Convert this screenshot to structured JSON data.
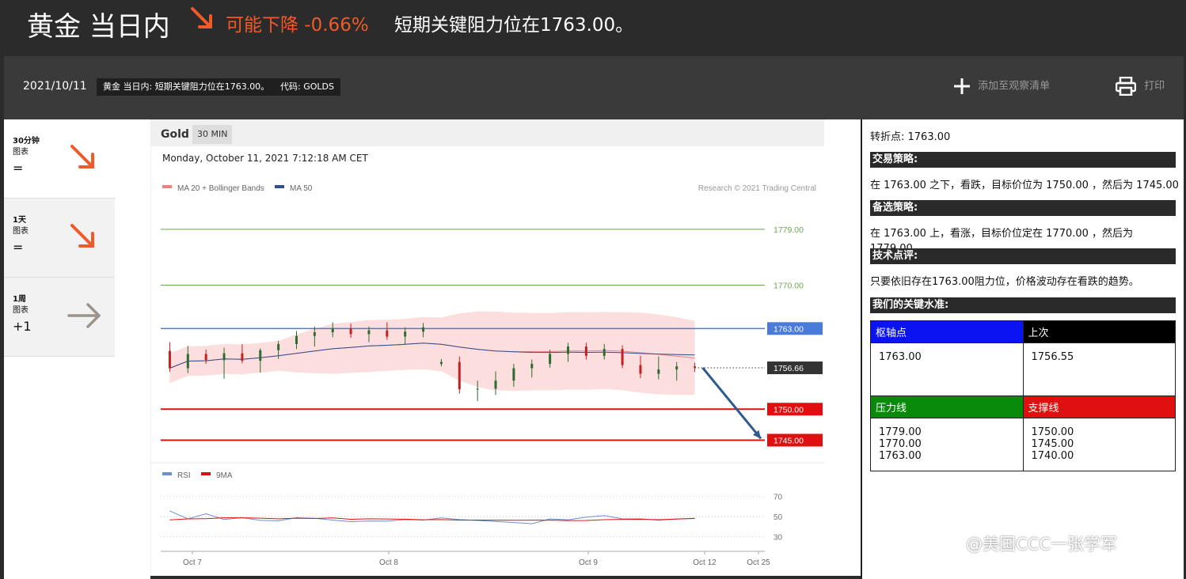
{
  "header": {
    "title": "黄金 当日内",
    "direction_label": "可能下降 -0.66%",
    "headline": "短期关键阻力位在1763.00。",
    "accent": "#f05a28"
  },
  "infobar": {
    "date": "2021/10/11",
    "summary_tag": "黄金 当日内: 短期关键阻力位在1763.00。",
    "code_tag": "代码: GOLDS",
    "watchlist_label": "添加至观察清单",
    "print_label": "打印"
  },
  "timeframes": [
    {
      "line1": "30分钟",
      "line2": "图表",
      "change": "=",
      "icon": "arrow-down-right-icon"
    },
    {
      "line1": "1天",
      "line2": "图表",
      "change": "=",
      "icon": "arrow-down-right-icon"
    },
    {
      "line1": "1周",
      "line2": "图表",
      "change": "+1",
      "icon": "arrow-right-icon"
    }
  ],
  "chart_header": {
    "symbol": "Gold",
    "timeframe": "30 MIN",
    "timestamp": "Monday, October 11, 2021 7:12:18 AM CET"
  },
  "chart_data": [
    {
      "type": "candlestick",
      "legend": [
        {
          "name": "MA 20 + Bollinger Bands",
          "color": "#f08080"
        },
        {
          "name": "MA 50",
          "color": "#2e4e8c"
        }
      ],
      "credit": "Research © 2021 Trading Central",
      "ylim": [
        1742,
        1786
      ],
      "levels": [
        {
          "value": 1779.0,
          "label": "1779.00",
          "color": "#6aa84f",
          "style": "thin",
          "label_style": "text"
        },
        {
          "value": 1770.0,
          "label": "1770.00",
          "color": "#6aa84f",
          "style": "thin",
          "label_style": "text"
        },
        {
          "value": 1763.0,
          "label": "1763.00",
          "color": "#4a7bd8",
          "style": "medium",
          "label_style": "box"
        },
        {
          "value": 1756.66,
          "label": "1756.66",
          "color": "#333333",
          "style": "dotted",
          "label_style": "box"
        },
        {
          "value": 1750.0,
          "label": "1750.00",
          "color": "#e01010",
          "style": "thick",
          "label_style": "box"
        },
        {
          "value": 1745.0,
          "label": "1745.00",
          "color": "#e01010",
          "style": "thick",
          "label_style": "box"
        }
      ],
      "x_ticks": [
        "Oct 7",
        "Oct 8",
        "Oct 9",
        "Oct 12",
        "Oct 25"
      ],
      "forecast_arrow": {
        "from": 1756.66,
        "to": 1745.0,
        "color": "#2e5a8c"
      },
      "candles": [
        {
          "o": 1759.4,
          "h": 1760.8,
          "l": 1756.0,
          "c": 1756.6
        },
        {
          "o": 1756.6,
          "h": 1760.2,
          "l": 1755.8,
          "c": 1758.9
        },
        {
          "o": 1758.9,
          "h": 1759.6,
          "l": 1757.3,
          "c": 1757.9
        },
        {
          "o": 1757.9,
          "h": 1759.9,
          "l": 1754.9,
          "c": 1759.0
        },
        {
          "o": 1759.0,
          "h": 1760.5,
          "l": 1757.4,
          "c": 1757.8
        },
        {
          "o": 1757.8,
          "h": 1759.8,
          "l": 1755.9,
          "c": 1759.5
        },
        {
          "o": 1759.5,
          "h": 1761.0,
          "l": 1758.1,
          "c": 1760.5
        },
        {
          "o": 1760.5,
          "h": 1762.6,
          "l": 1759.7,
          "c": 1761.8
        },
        {
          "o": 1761.8,
          "h": 1763.3,
          "l": 1760.1,
          "c": 1762.4
        },
        {
          "o": 1762.4,
          "h": 1764.0,
          "l": 1761.6,
          "c": 1763.0
        },
        {
          "o": 1763.0,
          "h": 1763.8,
          "l": 1761.5,
          "c": 1762.1
        },
        {
          "o": 1762.1,
          "h": 1763.3,
          "l": 1760.8,
          "c": 1762.7
        },
        {
          "o": 1762.7,
          "h": 1764.0,
          "l": 1761.2,
          "c": 1761.7
        },
        {
          "o": 1761.7,
          "h": 1763.2,
          "l": 1760.5,
          "c": 1762.5
        },
        {
          "o": 1762.5,
          "h": 1763.9,
          "l": 1761.6,
          "c": 1763.2
        },
        {
          "o": 1757.3,
          "h": 1758.1,
          "l": 1756.9,
          "c": 1757.6
        },
        {
          "o": 1757.6,
          "h": 1758.5,
          "l": 1752.5,
          "c": 1753.2
        },
        {
          "o": 1753.2,
          "h": 1754.6,
          "l": 1751.3,
          "c": 1753.3
        },
        {
          "o": 1753.3,
          "h": 1756.1,
          "l": 1752.3,
          "c": 1754.6
        },
        {
          "o": 1754.6,
          "h": 1757.3,
          "l": 1753.6,
          "c": 1756.6
        },
        {
          "o": 1756.6,
          "h": 1758.0,
          "l": 1755.1,
          "c": 1757.3
        },
        {
          "o": 1757.3,
          "h": 1759.6,
          "l": 1756.7,
          "c": 1758.9
        },
        {
          "o": 1758.9,
          "h": 1760.7,
          "l": 1757.6,
          "c": 1760.1
        },
        {
          "o": 1760.1,
          "h": 1760.7,
          "l": 1758.0,
          "c": 1758.6
        },
        {
          "o": 1758.6,
          "h": 1760.5,
          "l": 1758.0,
          "c": 1759.7
        },
        {
          "o": 1759.7,
          "h": 1760.3,
          "l": 1756.6,
          "c": 1757.1
        },
        {
          "o": 1757.1,
          "h": 1758.6,
          "l": 1755.0,
          "c": 1755.7
        },
        {
          "o": 1755.7,
          "h": 1758.5,
          "l": 1754.8,
          "c": 1756.4
        },
        {
          "o": 1756.4,
          "h": 1757.6,
          "l": 1754.6,
          "c": 1756.9
        },
        {
          "o": 1756.9,
          "h": 1757.5,
          "l": 1756.0,
          "c": 1756.7
        }
      ]
    },
    {
      "type": "line",
      "legend": [
        {
          "name": "RSI",
          "color": "#6a8fd8"
        },
        {
          "name": "9MA",
          "color": "#e01010"
        }
      ],
      "ylim": [
        25,
        80
      ],
      "y_ticks": [
        30,
        50,
        70
      ],
      "series": [
        {
          "name": "RSI",
          "values": [
            55.7,
            47.8,
            52.9,
            47.2,
            49.0,
            46.3,
            45.9,
            49.0,
            48.4,
            46.6,
            45.0,
            45.6,
            45.5,
            47.1,
            46.6,
            48.7,
            47.1,
            46.2,
            45.2,
            44.2,
            43.0,
            47.8,
            46.9,
            49.5,
            51.1,
            47.8,
            47.9,
            46.4,
            47.8,
            48.1
          ]
        },
        {
          "name": "9MA",
          "values": [
            46.8,
            47.8,
            48.0,
            48.9,
            48.9,
            48.5,
            47.9,
            48.5,
            48.2,
            48.7,
            47.4,
            47.9,
            47.7,
            47.5,
            46.9,
            47.1,
            46.6,
            46.6,
            46.5,
            46.4,
            46.5,
            46.5,
            46.1,
            46.2,
            47.0,
            47.3,
            47.4,
            47.0,
            47.6,
            48.3
          ]
        }
      ]
    }
  ],
  "analysis": {
    "pivot_text": "转折点: 1763.00",
    "strategy_title": "交易策略:",
    "strategy_text": "在 1763.00 之下，看跌，目标价位为 1750.00 ，然后为 1745.00 。",
    "alt_title": "备选策略:",
    "alt_text": "在 1763.00 上，看涨，目标价位定在 1770.00 ，然后为 1779.00。",
    "comment_title": "技术点评:",
    "comment_text": "只要依旧存在1763.00阻力位，价格波动存在看跌的趋势。",
    "levels_title": "我们的关键水准:",
    "table": {
      "pivot_header": "枢轴点",
      "pivot_color": "#0a14f0",
      "last_header": "上次",
      "last_color": "#000000",
      "pivot_value": "1763.00",
      "last_value": "1756.55",
      "res_header": "压力线",
      "res_color": "#0a8a0a",
      "sup_header": "支撑线",
      "sup_color": "#e01010",
      "resistances": [
        "1779.00",
        "1770.00",
        "1763.00"
      ],
      "supports": [
        "1750.00",
        "1745.00",
        "1740.00"
      ]
    }
  },
  "watermark": "@美国CCC一张学军"
}
